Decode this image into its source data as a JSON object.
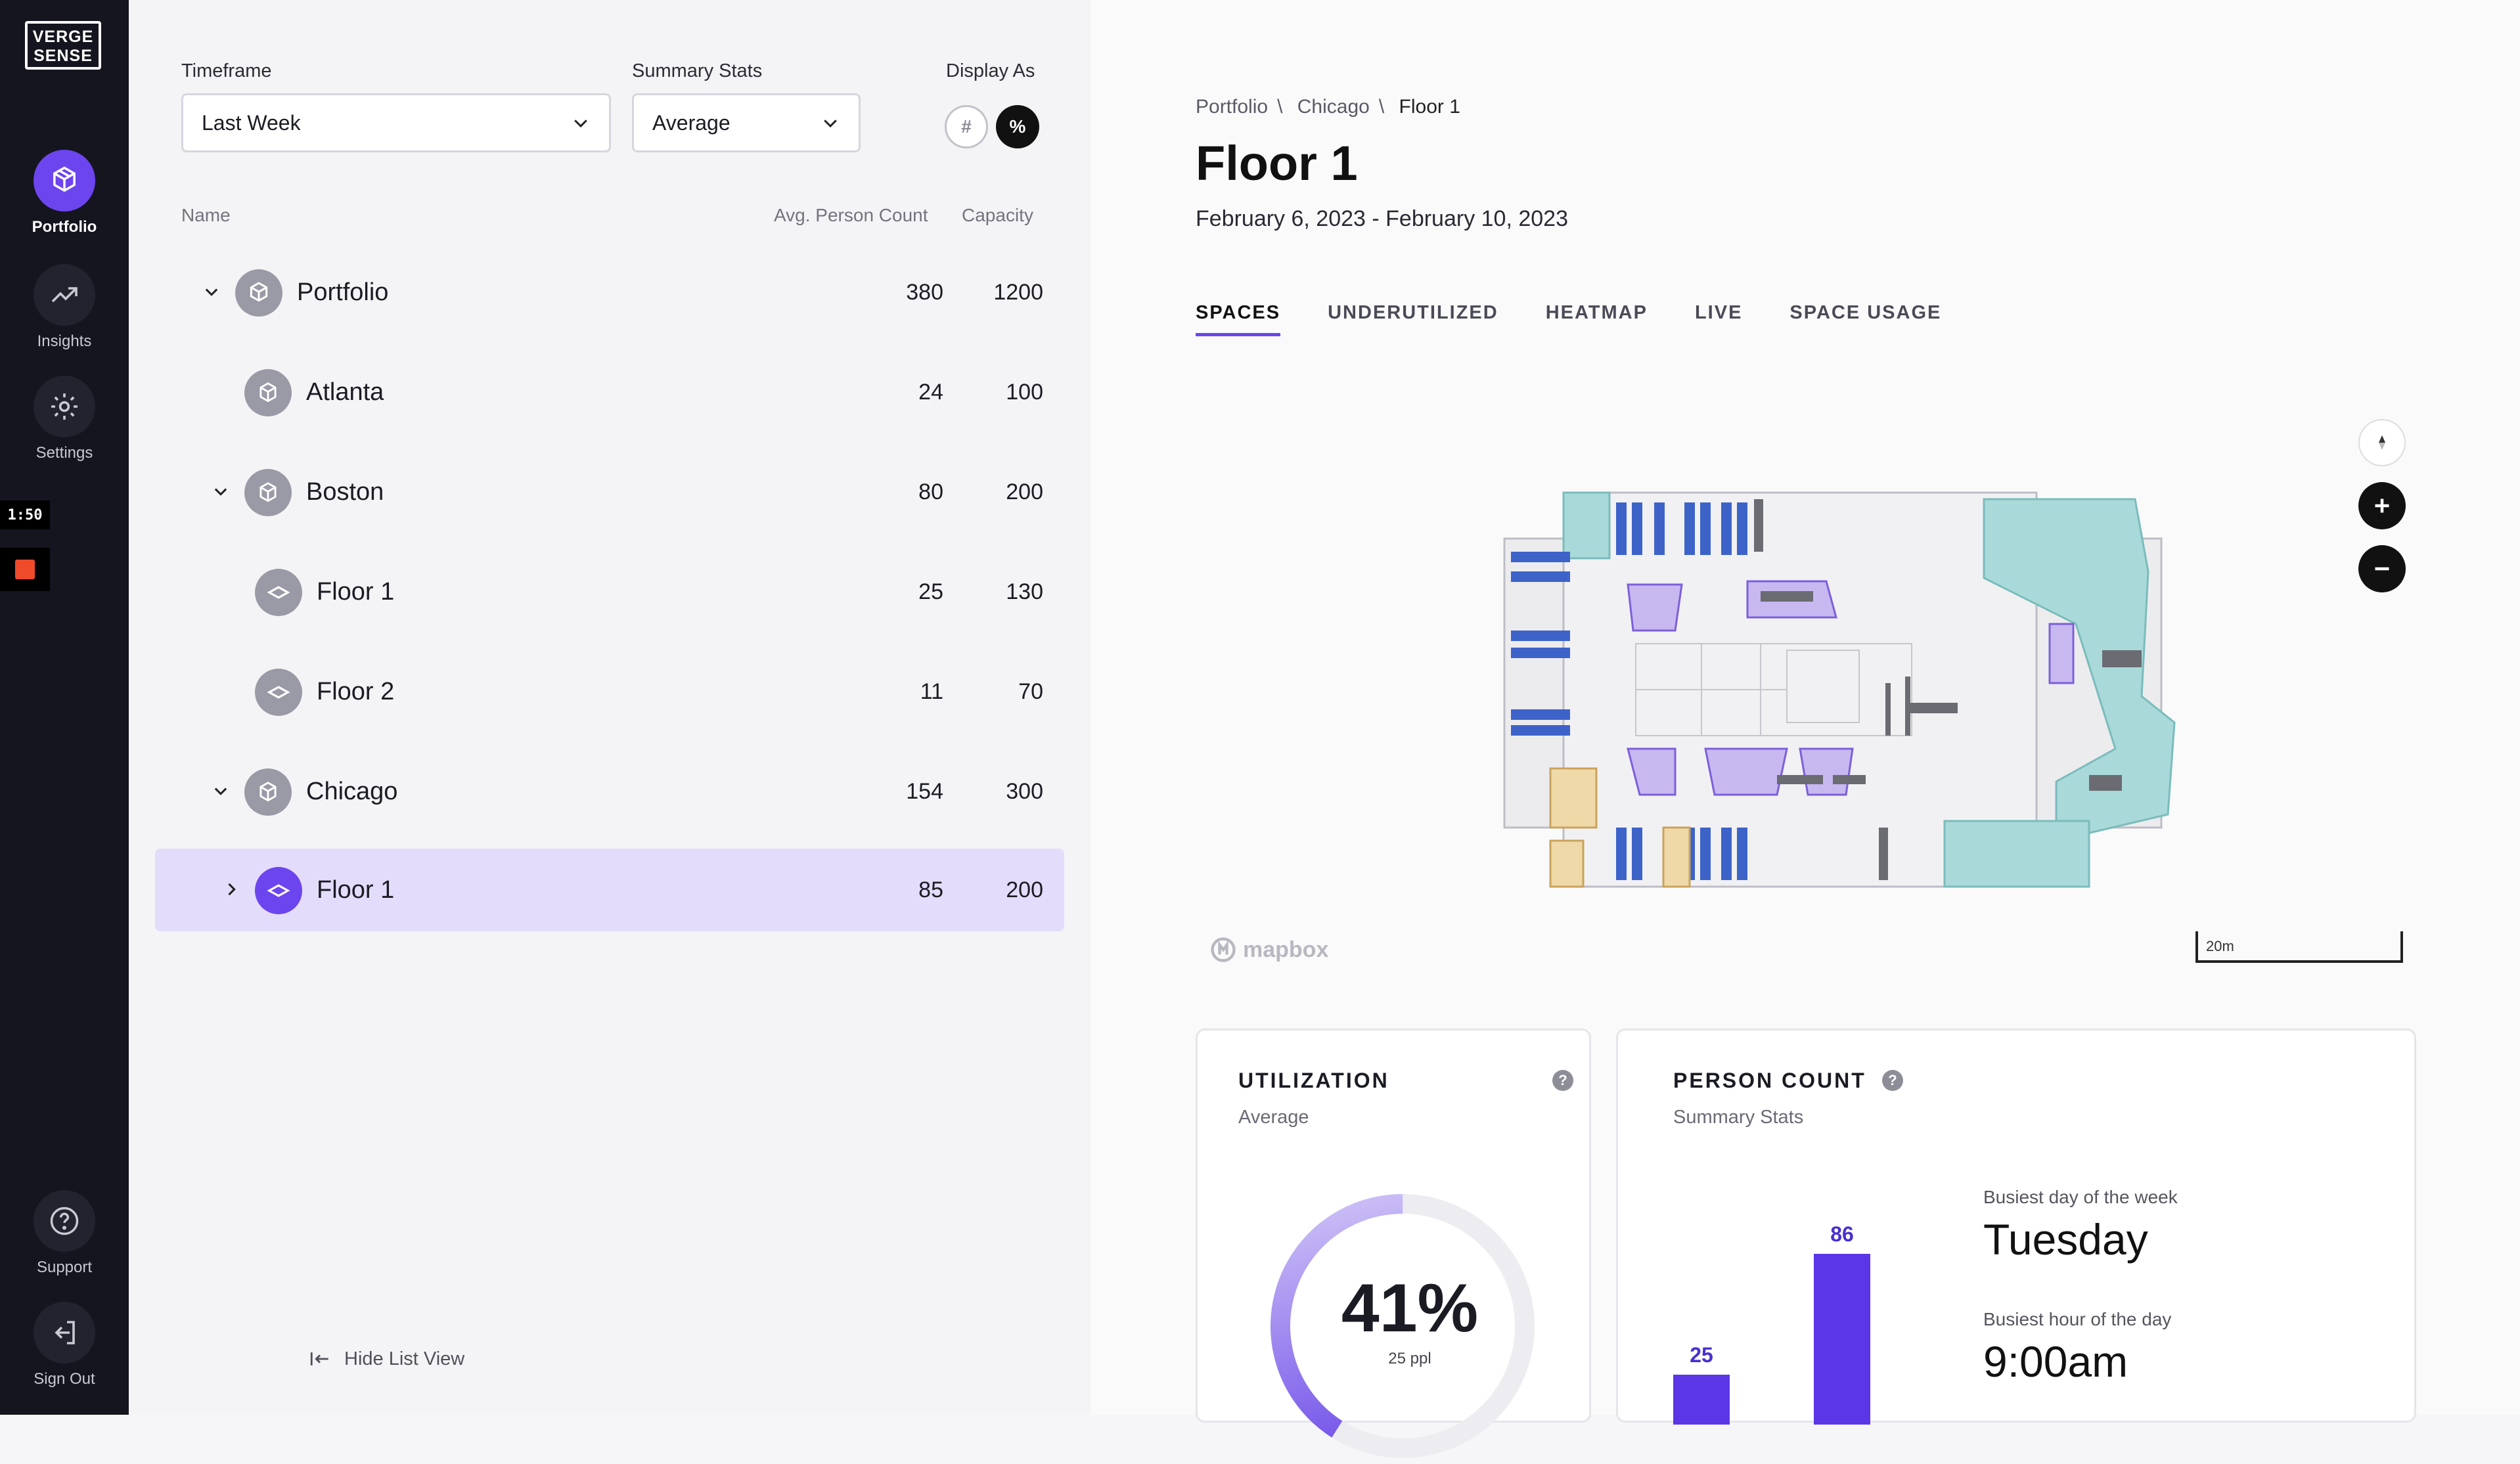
{
  "brand": {
    "logo_line1": "VERGE",
    "logo_line2": "SENSE"
  },
  "nav": {
    "items": [
      {
        "label": "Portfolio",
        "icon": "portfolio-cube-icon",
        "active": true
      },
      {
        "label": "Insights",
        "icon": "trend-icon",
        "active": false
      },
      {
        "label": "Settings",
        "icon": "gear-icon",
        "active": false
      }
    ],
    "bottom": [
      {
        "label": "Support",
        "icon": "help-circle-icon"
      },
      {
        "label": "Sign Out",
        "icon": "sign-out-icon"
      }
    ],
    "recording_time": "1:50"
  },
  "filters": {
    "timeframe_label": "Timeframe",
    "timeframe_value": "Last Week",
    "summary_label": "Summary Stats",
    "summary_value": "Average",
    "display_label": "Display As",
    "display_options": [
      "#",
      "%"
    ],
    "display_selected": "%"
  },
  "table": {
    "col_name": "Name",
    "col_count": "Avg. Person Count",
    "col_capacity": "Capacity",
    "rows": [
      {
        "name": "Portfolio",
        "count": "380",
        "capacity": "1200",
        "chevron": "down",
        "level": 0,
        "kind": "portfolio"
      },
      {
        "name": "Atlanta",
        "count": "24",
        "capacity": "100",
        "chevron": "none",
        "level": 1,
        "kind": "building"
      },
      {
        "name": "Boston",
        "count": "80",
        "capacity": "200",
        "chevron": "down",
        "level": 1,
        "kind": "building"
      },
      {
        "name": "Floor 1",
        "count": "25",
        "capacity": "130",
        "chevron": "none",
        "level": 2,
        "kind": "floor"
      },
      {
        "name": "Floor 2",
        "count": "11",
        "capacity": "70",
        "chevron": "none",
        "level": 2,
        "kind": "floor"
      },
      {
        "name": "Chicago",
        "count": "154",
        "capacity": "300",
        "chevron": "down",
        "level": 1,
        "kind": "building"
      },
      {
        "name": "Floor 1",
        "count": "85",
        "capacity": "200",
        "chevron": "right",
        "level": 2,
        "kind": "floor",
        "selected": true
      }
    ]
  },
  "hide_list": "Hide List View",
  "detail": {
    "breadcrumb": [
      "Portfolio",
      "Chicago",
      "Floor 1"
    ],
    "title": "Floor 1",
    "dates": "February 6, 2023 - February 10, 2023",
    "tabs": [
      "SPACES",
      "UNDERUTILIZED",
      "HEATMAP",
      "LIVE",
      "SPACE USAGE"
    ],
    "active_tab": "SPACES",
    "map_attribution": "mapbox",
    "scale_label": "20m"
  },
  "utilization": {
    "title": "UTILIZATION",
    "subtitle": "Average",
    "percent_label": "41%",
    "percent": 41,
    "ppl": "25 ppl"
  },
  "person_count": {
    "title": "PERSON COUNT",
    "subtitle": "Summary Stats",
    "busiest_day_label": "Busiest day of the week",
    "busiest_day": "Tuesday",
    "busiest_hour_label": "Busiest hour of the day",
    "busiest_hour": "9:00am"
  },
  "chart_data": {
    "type": "bar",
    "categories": [
      "",
      ""
    ],
    "values": [
      25,
      86
    ],
    "title": "",
    "xlabel": "",
    "ylabel": ""
  },
  "colors": {
    "accent": "#6c45ee",
    "bar": "#5b36e6",
    "nav_bg": "#15151f",
    "selected_row": "#e4dcfb"
  }
}
